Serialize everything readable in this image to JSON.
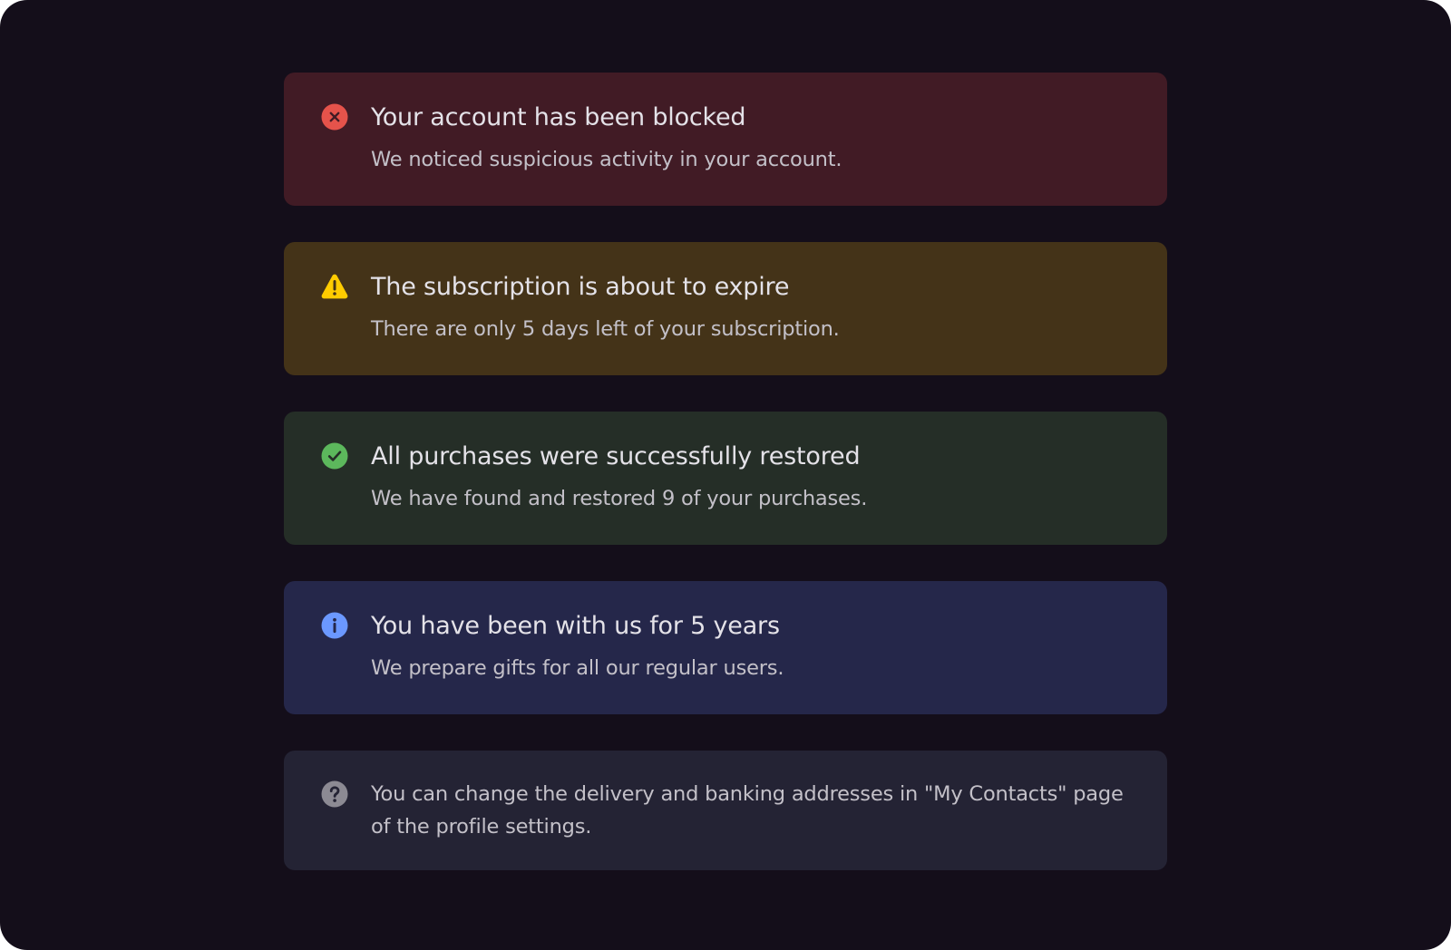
{
  "colors": {
    "page_background": "#140e1a",
    "danger_background": "#411b25",
    "danger_icon": "#e5534b",
    "warning_background": "#443318",
    "warning_icon": "#ffcc00",
    "success_background": "#252e27",
    "success_icon": "#5cb85c",
    "info_background": "#25274a",
    "info_icon": "#6b98ff",
    "neutral_background": "#242334",
    "neutral_icon": "#8c8a93"
  },
  "alerts": [
    {
      "kind": "danger",
      "icon": "error-x-icon",
      "title": "Your account has been blocked",
      "message": "We noticed suspicious activity in your account."
    },
    {
      "kind": "warning",
      "icon": "warning-triangle-icon",
      "title": "The subscription is about to expire",
      "message": "There are only 5 days left of your subscription."
    },
    {
      "kind": "success",
      "icon": "checkmark-icon",
      "title": "All purchases were successfully restored",
      "message": "We have found and restored 9 of your purchases."
    },
    {
      "kind": "info",
      "icon": "info-icon",
      "title": "You have been with us for 5 years",
      "message": "We prepare gifts for all our regular users."
    },
    {
      "kind": "neutral",
      "icon": "question-mark-icon",
      "message": "You can change the delivery and banking addresses in \"My Contacts\" page of the profile settings."
    }
  ]
}
